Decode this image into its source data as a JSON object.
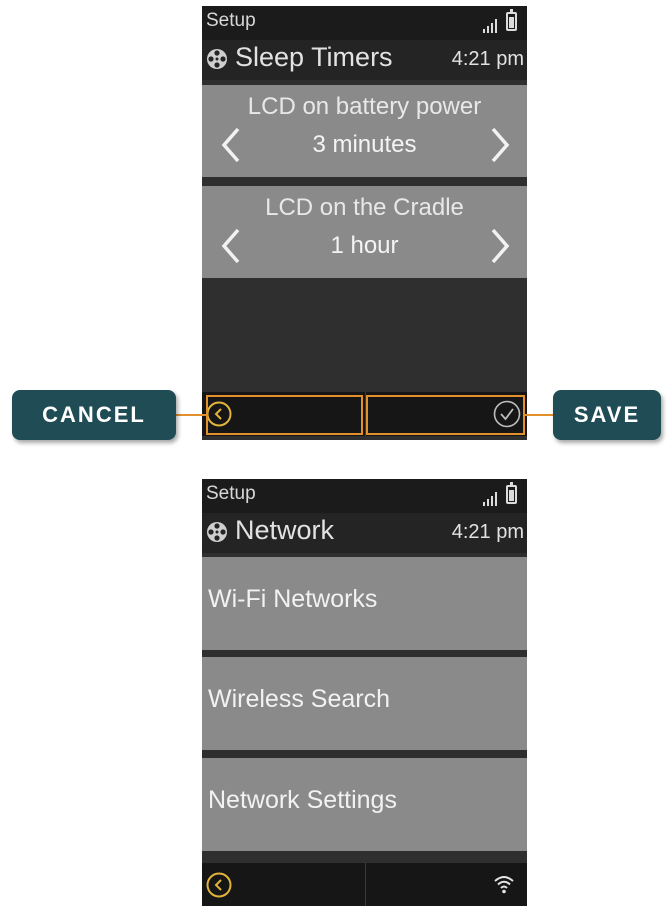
{
  "screens": [
    {
      "breadcrumb": "Setup",
      "title": "Sleep Timers",
      "time": "4:21 pm",
      "settings": [
        {
          "label": "LCD on battery power",
          "value": "3 minutes"
        },
        {
          "label": "LCD on the Cradle",
          "value": "1 hour"
        }
      ]
    },
    {
      "breadcrumb": "Setup",
      "title": "Network",
      "time": "4:21 pm",
      "items": [
        {
          "label": "Wi-Fi Networks"
        },
        {
          "label": "Wireless Search"
        },
        {
          "label": "Network Settings"
        }
      ]
    }
  ],
  "callouts": {
    "cancel": "CANCEL",
    "save": "SAVE"
  },
  "colors": {
    "accent": "#e2902b",
    "callout": "#1f4c55",
    "panel": "#8a8a8a",
    "screen_bg": "#2f2f2f"
  },
  "icons": [
    "signal-icon",
    "battery-icon",
    "film-reel-icon",
    "chevron-left-icon",
    "chevron-right-icon",
    "back-circle-icon",
    "check-circle-icon",
    "wifi-icon"
  ]
}
